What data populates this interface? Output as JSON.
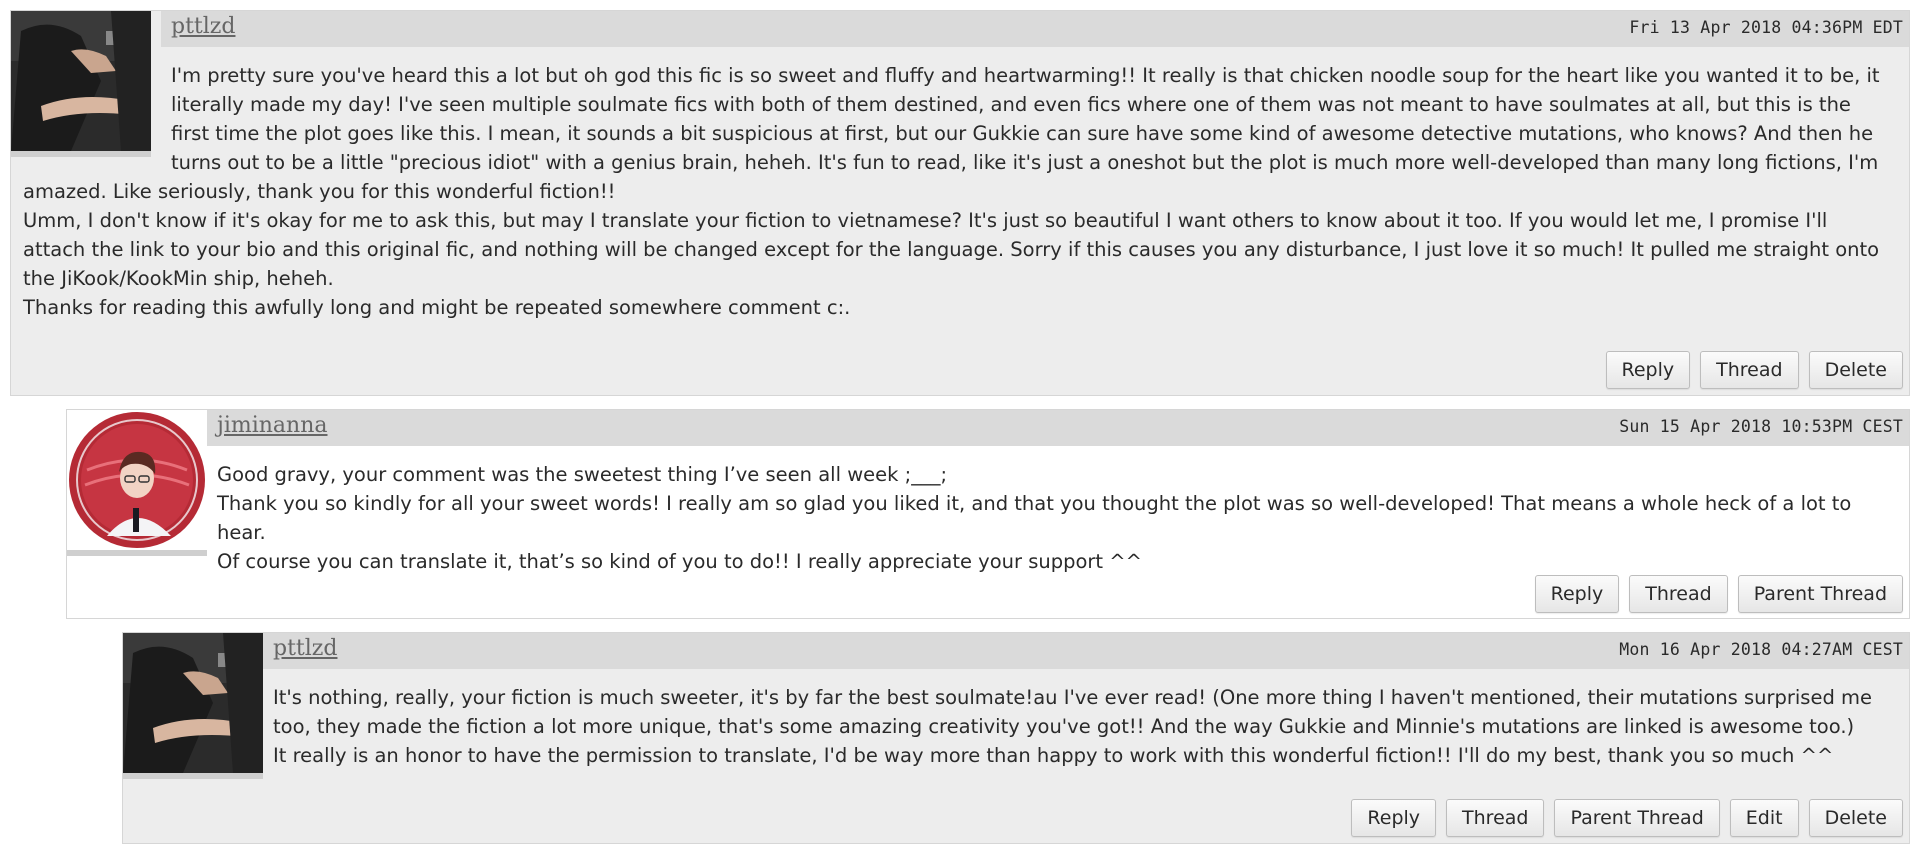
{
  "comments": [
    {
      "username": "pttlzd",
      "datetime": "Fri 13 Apr 2018 04:36PM EDT",
      "avatar_icon": "dark-clothed-person-photo",
      "paragraphs": [
        "I'm pretty sure you've heard this a lot but oh god this fic is so sweet and fluffy and heartwarming!! It really is that chicken noodle soup for the heart like you wanted it to be, it literally made my day! I've seen multiple soulmate fics with both of them destined, and even fics where one of them was not meant to have soulmates at all, but this is the first time the plot goes like this. I mean, it sounds a bit suspicious at first, but our Gukkie can sure have some kind of awesome detective mutations, who knows? And then he turns out to be a little \"precious idiot\" with a genius brain, heheh. It's fun to read, like it's just a oneshot but the plot is much more well-developed than many long fictions, I'm amazed. Like seriously, thank you for this wonderful fiction!!",
        "Umm, I don't know if it's okay for me to ask this, but may I translate your fiction to vietnamese? It's just so beautiful I want others to know about it too. If you would let me, I promise I'll attach the link to your bio and this original fic, and nothing will be changed except for the language. Sorry if this causes you any disturbance, I just love it so much! It pulled me straight onto the JiKook/KookMin ship, heheh.",
        "Thanks for reading this awfully long and might be repeated somewhere comment c:."
      ],
      "actions": [
        "Reply",
        "Thread",
        "Delete"
      ]
    },
    {
      "username": "jiminanna",
      "datetime": "Sun 15 Apr 2018 10:53PM CEST",
      "avatar_icon": "circular-red-portrait",
      "paragraphs": [
        "Good gravy, your comment was the sweetest thing I’ve seen all week ;___;",
        "Thank you so kindly for all your sweet words! I really am so glad you liked it, and that you thought the plot was so well-developed! That means a whole heck of a lot to hear.",
        "Of course you can translate it, that’s so kind of you to do!! I really appreciate your support ^^"
      ],
      "actions": [
        "Reply",
        "Thread",
        "Parent Thread"
      ]
    },
    {
      "username": "pttlzd",
      "datetime": "Mon 16 Apr 2018 04:27AM CEST",
      "avatar_icon": "dark-clothed-person-photo",
      "paragraphs": [
        "It's nothing, really, your fiction is much sweeter, it's by far the best soulmate!au I've ever read! (One more thing I haven't mentioned, their mutations surprised me too, they made the fiction a lot more unique, that's some amazing creativity you've got!! And the way Gukkie and Minnie's mutations are linked is awesome too.)",
        "It really is an honor to have the permission to translate, I'd be way more than happy to work with this wonderful fiction!! I'll do my best, thank you so much ^^"
      ],
      "actions": [
        "Reply",
        "Thread",
        "Parent Thread",
        "Edit",
        "Delete"
      ]
    }
  ]
}
